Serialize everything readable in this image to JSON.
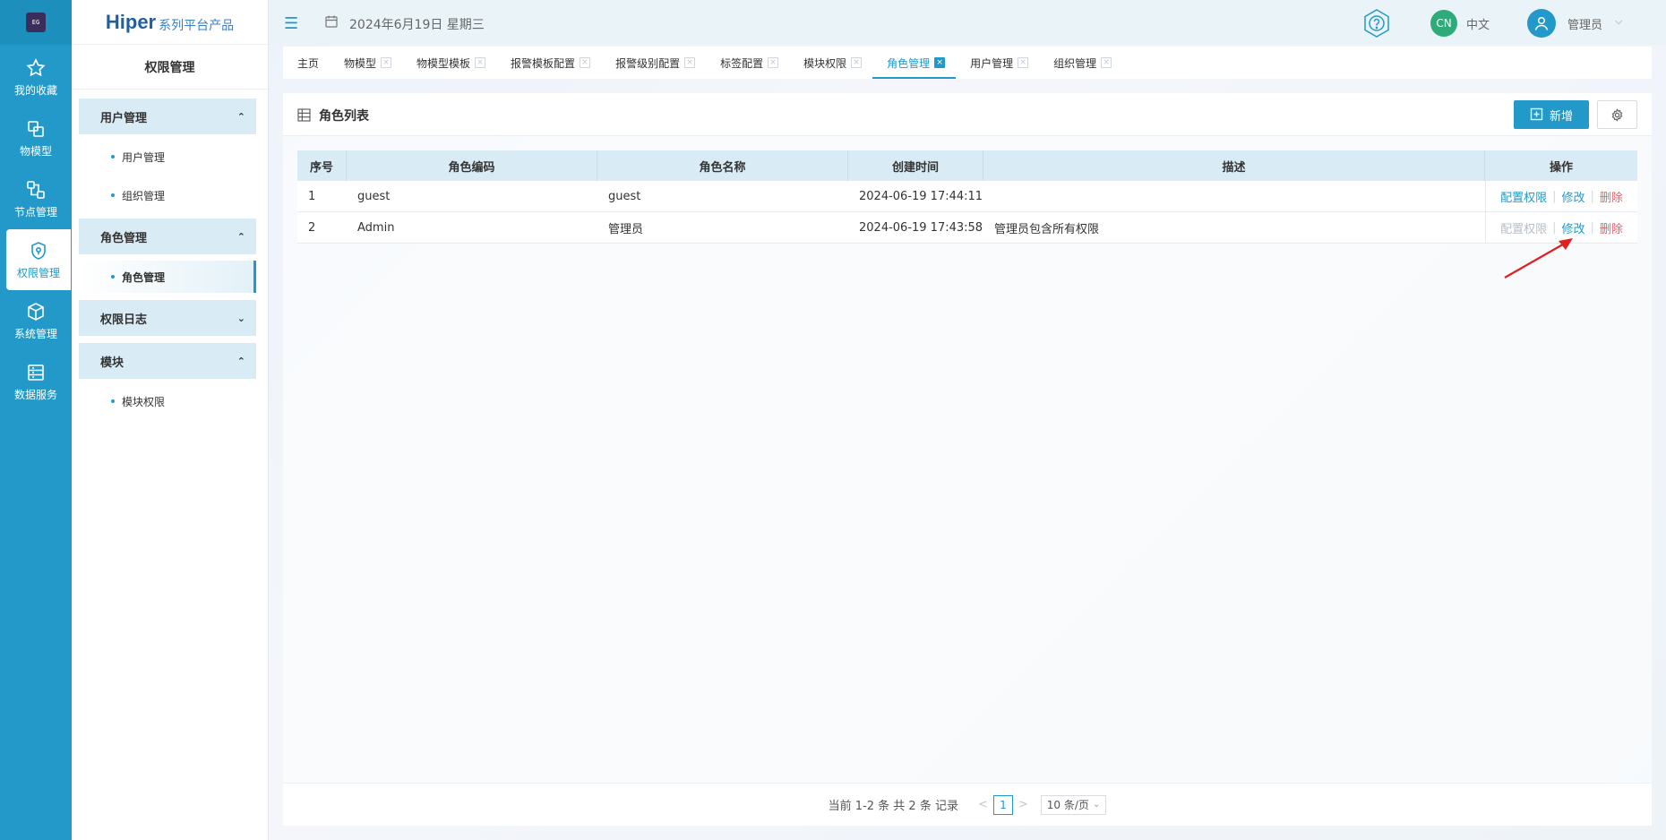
{
  "rail": {
    "items": [
      {
        "label": "我的收藏",
        "icon": "star-icon"
      },
      {
        "label": "物模型",
        "icon": "model-icon"
      },
      {
        "label": "节点管理",
        "icon": "node-icon"
      },
      {
        "label": "权限管理",
        "icon": "shield-icon"
      },
      {
        "label": "系统管理",
        "icon": "box-icon"
      },
      {
        "label": "数据服务",
        "icon": "database-icon"
      }
    ]
  },
  "sidebar": {
    "brand_main": "Hiper",
    "brand_sub": "系列平台产品",
    "title": "权限管理",
    "groups": [
      {
        "label": "用户管理",
        "chevron": "^"
      },
      {
        "label": "角色管理",
        "chevron": "^"
      },
      {
        "label": "权限日志",
        "chevron": "v"
      },
      {
        "label": "模块",
        "chevron": "^"
      }
    ],
    "subitems": [
      {
        "label": "用户管理"
      },
      {
        "label": "组织管理"
      },
      {
        "label": "角色管理"
      },
      {
        "label": "模块权限"
      }
    ]
  },
  "header": {
    "date": "2024年6月19日 星期三",
    "lang_badge": "CN",
    "lang": "中文",
    "user": "管理员"
  },
  "tabs": [
    {
      "label": "主页"
    },
    {
      "label": "物模型"
    },
    {
      "label": "物模型模板"
    },
    {
      "label": "报警模板配置"
    },
    {
      "label": "报警级别配置"
    },
    {
      "label": "标签配置"
    },
    {
      "label": "模块权限"
    },
    {
      "label": "角色管理"
    },
    {
      "label": "用户管理"
    },
    {
      "label": "组织管理"
    }
  ],
  "panel": {
    "title": "角色列表",
    "add_label": "新增"
  },
  "table": {
    "headers": [
      "序号",
      "角色编码",
      "角色名称",
      "创建时间",
      "描述",
      "操作"
    ],
    "rows": [
      {
        "no": "1",
        "code": "guest",
        "name": "guest",
        "created": "2024-06-19 17:44:11",
        "desc": ""
      },
      {
        "no": "2",
        "code": "Admin",
        "name": "管理员",
        "created": "2024-06-19 17:43:58",
        "desc": "管理员包含所有权限"
      }
    ],
    "actions": {
      "config": "配置权限",
      "edit": "修改",
      "delete": "删除",
      "sep": "|"
    }
  },
  "pagination": {
    "summary": "当前 1-2 条 共 2 条 记录",
    "prev": "<",
    "page": "1",
    "next": ">",
    "page_size": "10 条/页"
  },
  "colors": {
    "accent": "#2299c9",
    "danger": "#e8626a",
    "annotation": "#e02020"
  }
}
